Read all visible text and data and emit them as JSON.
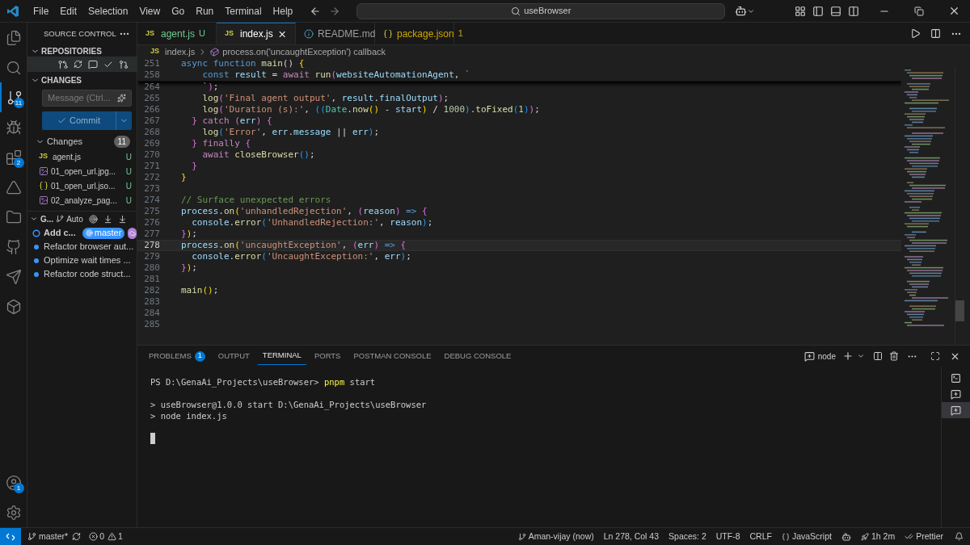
{
  "title_bar": {
    "menu": [
      "File",
      "Edit",
      "Selection",
      "View",
      "Go",
      "Run",
      "Terminal",
      "Help"
    ],
    "search": "useBrowser"
  },
  "activity_bar": {
    "items": [
      {
        "kind": "files",
        "selected": false
      },
      {
        "kind": "search",
        "selected": false
      },
      {
        "kind": "source-control",
        "selected": true,
        "badge": "11"
      },
      {
        "kind": "debug",
        "selected": false
      },
      {
        "kind": "extensions",
        "selected": false,
        "badge": "2"
      },
      {
        "kind": "pyramid",
        "selected": false
      },
      {
        "kind": "folder",
        "selected": false
      },
      {
        "kind": "github",
        "selected": false
      },
      {
        "kind": "postman",
        "selected": false
      },
      {
        "kind": "cube",
        "selected": false
      }
    ],
    "bottom": [
      {
        "kind": "account",
        "badge": "1"
      },
      {
        "kind": "settings"
      }
    ]
  },
  "sidebar": {
    "title": "SOURCE CONTROL",
    "repositories": {
      "label": "REPOSITORIES",
      "expanded": true
    },
    "changes_section": {
      "label": "CHANGES",
      "expanded": true
    },
    "message": {
      "placeholder": "Message (Ctrl..."
    },
    "commit_button": "Commit",
    "changes": {
      "label": "Changes",
      "count": "11",
      "expanded": true,
      "files": [
        {
          "name": "agent.js",
          "kind": "js",
          "icon_label": "JS",
          "status": "U"
        },
        {
          "name": "01_open_url.jpg...",
          "kind": "image",
          "status": "U"
        },
        {
          "name": "01_open_url.jso...",
          "kind": "json",
          "status": "U"
        },
        {
          "name": "02_analyze_pag...",
          "kind": "image",
          "status": "U"
        }
      ]
    },
    "graph": {
      "label": "G...",
      "expanded": true,
      "mode": "Auto",
      "commits": [
        {
          "message": "Add c...",
          "current": true,
          "branch": "master"
        },
        {
          "message": "Refactor browser aut...",
          "current": false
        },
        {
          "message": "Optimize wait times ...",
          "current": false
        },
        {
          "message": "Refactor code struct...",
          "current": false
        }
      ]
    }
  },
  "editor": {
    "tabs": [
      {
        "label": "agent.js",
        "kind": "js",
        "icon_label": "JS",
        "status": "U",
        "selected": false
      },
      {
        "label": "index.js",
        "kind": "js",
        "icon_label": "JS",
        "selected": true
      },
      {
        "label": "README.md",
        "kind": "info",
        "selected": false
      },
      {
        "label": "package.json",
        "kind": "json",
        "status": "1",
        "selected": false
      }
    ],
    "breadcrumb": {
      "icon_label": "JS",
      "file": "index.js",
      "symbol": "process.on('uncaughtException') callback"
    },
    "sticky_lines": [
      {
        "number": "251",
        "tokens": [
          {
            "text": "async ",
            "kind": "kw"
          },
          {
            "text": "function ",
            "kind": "kw"
          },
          {
            "text": "main",
            "kind": "fn"
          },
          {
            "text": "() ",
            "kind": "p"
          },
          {
            "text": "{",
            "kind": "b1"
          }
        ]
      },
      {
        "number": "258",
        "tokens": [
          {
            "text": "    const ",
            "kind": "kw"
          },
          {
            "text": "result",
            "kind": "var"
          },
          {
            "text": " = ",
            "kind": "p"
          },
          {
            "text": "await ",
            "kind": "ctrl"
          },
          {
            "text": "run",
            "kind": "fn"
          },
          {
            "text": "(",
            "kind": "b2"
          },
          {
            "text": "websiteAutomationAgent",
            "kind": "var"
          },
          {
            "text": ", ",
            "kind": "p"
          },
          {
            "text": "`",
            "kind": "str"
          }
        ]
      }
    ],
    "lines": [
      {
        "number": "264",
        "current": false,
        "tokens": [
          {
            "text": "    `",
            "kind": "str"
          },
          {
            "text": ")",
            "kind": "b2"
          },
          {
            "text": ";",
            "kind": "p"
          }
        ]
      },
      {
        "number": "265",
        "current": false,
        "tokens": [
          {
            "text": "    log",
            "kind": "fn"
          },
          {
            "text": "(",
            "kind": "b2"
          },
          {
            "text": "'Final agent output'",
            "kind": "str"
          },
          {
            "text": ", ",
            "kind": "p"
          },
          {
            "text": "result",
            "kind": "var"
          },
          {
            "text": ".",
            "kind": "p"
          },
          {
            "text": "finalOutput",
            "kind": "var"
          },
          {
            "text": ")",
            "kind": "b2"
          },
          {
            "text": ";",
            "kind": "p"
          }
        ]
      },
      {
        "number": "266",
        "current": false,
        "tokens": [
          {
            "text": "    log",
            "kind": "fn"
          },
          {
            "text": "(",
            "kind": "b2"
          },
          {
            "text": "'Duration (s):'",
            "kind": "str"
          },
          {
            "text": ", ",
            "kind": "p"
          },
          {
            "text": "((",
            "kind": "b3"
          },
          {
            "text": "Date",
            "kind": "cls"
          },
          {
            "text": ".",
            "kind": "p"
          },
          {
            "text": "now",
            "kind": "fn"
          },
          {
            "text": "()",
            "kind": "b1"
          },
          {
            "text": " - ",
            "kind": "p"
          },
          {
            "text": "start",
            "kind": "var"
          },
          {
            "text": ")",
            "kind": "b1"
          },
          {
            "text": " / ",
            "kind": "p"
          },
          {
            "text": "1000",
            "kind": "num"
          },
          {
            "text": ")",
            "kind": "b3"
          },
          {
            "text": ".",
            "kind": "p"
          },
          {
            "text": "toFixed",
            "kind": "fn"
          },
          {
            "text": "(",
            "kind": "b3"
          },
          {
            "text": "1",
            "kind": "num"
          },
          {
            "text": ")",
            "kind": "b3"
          },
          {
            "text": ")",
            "kind": "b2"
          },
          {
            "text": ";",
            "kind": "p"
          }
        ]
      },
      {
        "number": "267",
        "current": false,
        "tokens": [
          {
            "text": "  }",
            "kind": "b2"
          },
          {
            "text": " catch ",
            "kind": "ctrl"
          },
          {
            "text": "(",
            "kind": "b2"
          },
          {
            "text": "err",
            "kind": "var"
          },
          {
            "text": ")",
            "kind": "b2"
          },
          {
            "text": " {",
            "kind": "b2"
          }
        ]
      },
      {
        "number": "268",
        "current": false,
        "tokens": [
          {
            "text": "    log",
            "kind": "fn"
          },
          {
            "text": "(",
            "kind": "b3"
          },
          {
            "text": "'Error'",
            "kind": "str"
          },
          {
            "text": ", ",
            "kind": "p"
          },
          {
            "text": "err",
            "kind": "var"
          },
          {
            "text": ".",
            "kind": "p"
          },
          {
            "text": "message",
            "kind": "var"
          },
          {
            "text": " || ",
            "kind": "p"
          },
          {
            "text": "err",
            "kind": "var"
          },
          {
            "text": ")",
            "kind": "b3"
          },
          {
            "text": ";",
            "kind": "p"
          }
        ]
      },
      {
        "number": "269",
        "current": false,
        "tokens": [
          {
            "text": "  }",
            "kind": "b2"
          },
          {
            "text": " finally ",
            "kind": "ctrl"
          },
          {
            "text": "{",
            "kind": "b2"
          }
        ]
      },
      {
        "number": "270",
        "current": false,
        "tokens": [
          {
            "text": "    await ",
            "kind": "ctrl"
          },
          {
            "text": "closeBrowser",
            "kind": "fn"
          },
          {
            "text": "()",
            "kind": "b3"
          },
          {
            "text": ";",
            "kind": "p"
          }
        ]
      },
      {
        "number": "271",
        "current": false,
        "tokens": [
          {
            "text": "  }",
            "kind": "b2"
          }
        ]
      },
      {
        "number": "272",
        "current": false,
        "tokens": [
          {
            "text": "}",
            "kind": "b1"
          }
        ]
      },
      {
        "number": "273",
        "current": false
      },
      {
        "number": "274",
        "current": false,
        "tokens": [
          {
            "text": "// Surface unexpected errors",
            "kind": "cmt"
          }
        ]
      },
      {
        "number": "275",
        "current": false,
        "tokens": [
          {
            "text": "process",
            "kind": "var"
          },
          {
            "text": ".",
            "kind": "p"
          },
          {
            "text": "on",
            "kind": "fn"
          },
          {
            "text": "(",
            "kind": "b1"
          },
          {
            "text": "'unhandledRejection'",
            "kind": "str"
          },
          {
            "text": ", ",
            "kind": "p"
          },
          {
            "text": "(",
            "kind": "b2"
          },
          {
            "text": "reason",
            "kind": "var"
          },
          {
            "text": ")",
            "kind": "b2"
          },
          {
            "text": " => ",
            "kind": "kw"
          },
          {
            "text": "{",
            "kind": "b2"
          }
        ]
      },
      {
        "number": "276",
        "current": false,
        "tokens": [
          {
            "text": "  console",
            "kind": "var"
          },
          {
            "text": ".",
            "kind": "p"
          },
          {
            "text": "error",
            "kind": "fn"
          },
          {
            "text": "(",
            "kind": "b3"
          },
          {
            "text": "'UnhandledRejection:'",
            "kind": "str"
          },
          {
            "text": ", ",
            "kind": "p"
          },
          {
            "text": "reason",
            "kind": "var"
          },
          {
            "text": ")",
            "kind": "b3"
          },
          {
            "text": ";",
            "kind": "p"
          }
        ]
      },
      {
        "number": "277",
        "current": false,
        "tokens": [
          {
            "text": "}",
            "kind": "b2"
          },
          {
            "text": ")",
            "kind": "b1"
          },
          {
            "text": ";",
            "kind": "p"
          }
        ]
      },
      {
        "number": "278",
        "current": true,
        "tokens": [
          {
            "text": "process",
            "kind": "var"
          },
          {
            "text": ".",
            "kind": "p"
          },
          {
            "text": "on",
            "kind": "fn"
          },
          {
            "text": "(",
            "kind": "b1"
          },
          {
            "text": "'uncaughtException'",
            "kind": "str"
          },
          {
            "text": ", ",
            "kind": "p"
          },
          {
            "text": "(",
            "kind": "b2"
          },
          {
            "text": "err",
            "kind": "var"
          },
          {
            "text": ")",
            "kind": "b2"
          },
          {
            "text": " => ",
            "kind": "kw"
          },
          {
            "text": "{",
            "kind": "b2"
          }
        ]
      },
      {
        "number": "279",
        "current": false,
        "tokens": [
          {
            "text": "  console",
            "kind": "var"
          },
          {
            "text": ".",
            "kind": "p"
          },
          {
            "text": "error",
            "kind": "fn"
          },
          {
            "text": "(",
            "kind": "b3"
          },
          {
            "text": "'UncaughtException:'",
            "kind": "str"
          },
          {
            "text": ", ",
            "kind": "p"
          },
          {
            "text": "err",
            "kind": "var"
          },
          {
            "text": ")",
            "kind": "b3"
          },
          {
            "text": ";",
            "kind": "p"
          }
        ]
      },
      {
        "number": "280",
        "current": false,
        "tokens": [
          {
            "text": "}",
            "kind": "b2"
          },
          {
            "text": ")",
            "kind": "b1"
          },
          {
            "text": ";",
            "kind": "p"
          }
        ]
      },
      {
        "number": "281",
        "current": false
      },
      {
        "number": "282",
        "current": false,
        "tokens": [
          {
            "text": "main",
            "kind": "fn"
          },
          {
            "text": "()",
            "kind": "b1"
          },
          {
            "text": ";",
            "kind": "p"
          }
        ]
      },
      {
        "number": "283",
        "current": false
      },
      {
        "number": "284",
        "current": false
      },
      {
        "number": "285",
        "current": false
      }
    ]
  },
  "panel": {
    "tabs": [
      {
        "label": "PROBLEMS",
        "selected": false,
        "badge": "1"
      },
      {
        "label": "OUTPUT",
        "selected": false
      },
      {
        "label": "TERMINAL",
        "selected": true
      },
      {
        "label": "PORTS",
        "selected": false
      },
      {
        "label": "POSTMAN CONSOLE",
        "selected": false
      },
      {
        "label": "DEBUG CONSOLE",
        "selected": false
      }
    ],
    "profile": "node",
    "terminal": [
      {
        "kind": "prompt",
        "prompt": "PS D:\\GenaAi_Projects\\useBrowser> ",
        "command": "pnpm",
        "args": " start"
      },
      {
        "kind": "blank"
      },
      {
        "kind": "output",
        "text": "> useBrowser@1.0.0 start D:\\GenaAi_Projects\\useBrowser"
      },
      {
        "kind": "output",
        "text": "> node index.js"
      },
      {
        "kind": "blank"
      },
      {
        "kind": "cursor"
      }
    ],
    "terminal_list": [
      {
        "kind": "terminal",
        "selected": false
      },
      {
        "kind": "chat",
        "selected": false
      },
      {
        "kind": "chat",
        "selected": true
      }
    ]
  },
  "status_bar": {
    "branch": "master*",
    "errors": "0",
    "warnings": "1",
    "right": [
      {
        "kind": "author",
        "text": "Aman-vijay (now)"
      },
      {
        "kind": "text",
        "text": "Ln 278, Col 43"
      },
      {
        "kind": "text",
        "text": "Spaces: 2"
      },
      {
        "kind": "text",
        "text": "UTF-8"
      },
      {
        "kind": "text",
        "text": "CRLF"
      },
      {
        "kind": "language",
        "text": "JavaScript"
      },
      {
        "kind": "copilot"
      },
      {
        "kind": "timer",
        "text": "1h 2m"
      },
      {
        "kind": "prettier",
        "text": "Prettier"
      },
      {
        "kind": "bell"
      }
    ]
  }
}
